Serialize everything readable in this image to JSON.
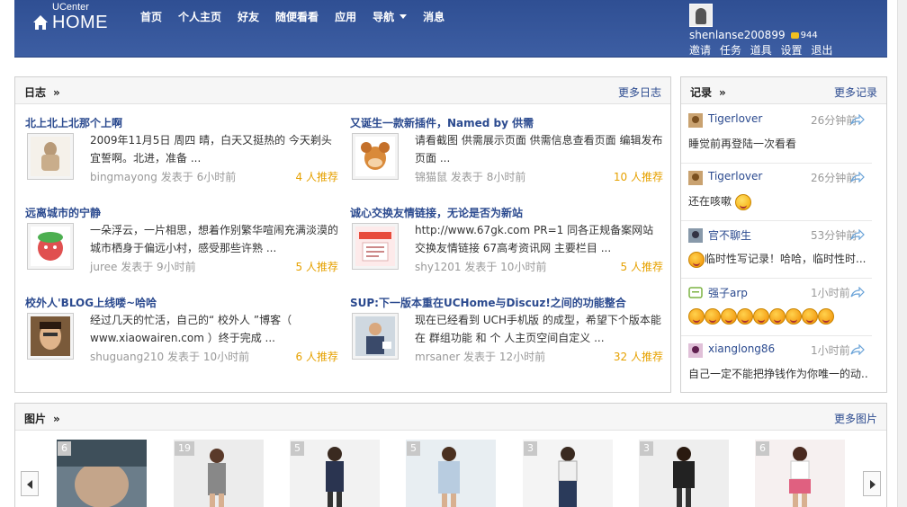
{
  "header": {
    "logo_small": "UCenter",
    "logo_big": "HOME",
    "nav": [
      "首页",
      "个人主页",
      "好友",
      "随便看看",
      "应用",
      "导航",
      "消息"
    ],
    "username": "shenlanse200899",
    "credit": "944",
    "user_links": [
      "邀请",
      "任务",
      "道具",
      "设置",
      "退出"
    ]
  },
  "blog": {
    "title": "日志",
    "arrow": "»",
    "more": "更多日志",
    "entries": [
      {
        "title": "北上北上北那个上啊",
        "text": "2009年11月5日 周四 晴，白天又挺热的  今天剃头宜誓啊。北进，准备 ...",
        "author": "bingmayong",
        "posted": "发表于",
        "time": "6小时前",
        "rec": "4 人推荐"
      },
      {
        "title": "又诞生一款新插件，Named by 供需",
        "text": "请看截图  供需展示页面 供需信息查看页面 编辑发布页面  ...",
        "author": "锦猫鼠",
        "posted": "发表于",
        "time": "8小时前",
        "rec": "10 人推荐"
      },
      {
        "title": "远离城市的宁静",
        "text": " 一朵浮云，一片相思，想着作别繁华喧闹充满淡漠的城市栖身于偏远小村，感受那些许熟  ...",
        "author": "juree",
        "posted": "发表于",
        "time": "9小时前",
        "rec": "5 人推荐"
      },
      {
        "title": "诚心交换友情链接，无论是否为新站",
        "text": "http://www.67gk.com PR=1 同各正规备案网站交换友情链接 67高考资讯网 主要栏目 ...",
        "author": "shy1201",
        "posted": "发表于",
        "time": "10小时前",
        "rec": "5 人推荐"
      },
      {
        "title": "校外人'BLOG上线喽~哈哈",
        "text": " 经过几天的忙活，自己的“ 校外人 ”博客（ www.xiaowairen.com ）终于完成  ...",
        "author": "shuguang210",
        "posted": "发表于",
        "time": "10小时前",
        "rec": "6 人推荐"
      },
      {
        "title": "SUP:下一版本重在UCHome与Discuz!之间的功能整合",
        "text": "现在已经看到 UCH手机版 的成型，希望下个版本能在 群组功能 和 个 人主页空间自定义  ...",
        "author": "mrsaner",
        "posted": "发表于",
        "time": "12小时前",
        "rec": "32 人推荐"
      }
    ]
  },
  "records": {
    "title": "记录",
    "arrow": "»",
    "more": "更多记录",
    "items": [
      {
        "name": "Tigerlover",
        "time": "26分钟前",
        "body": "睡觉前再登陆一次看看"
      },
      {
        "name": "Tigerlover",
        "time": "26分钟前",
        "body": "还在咳嗽"
      },
      {
        "name": "官不聊生",
        "time": "53分钟前",
        "body": "临时性写记录！哈哈，临时性时..."
      },
      {
        "name": "强子arp",
        "time": "1小时前",
        "body": ""
      },
      {
        "name": "xianglong86",
        "time": "1小时前",
        "body": "自己一定不能把挣钱作为你唯一的动..."
      }
    ]
  },
  "photos": {
    "title": "图片",
    "arrow": "»",
    "more": "更多图片",
    "counts": [
      "6",
      "19",
      "5",
      "5",
      "3",
      "3",
      "6"
    ]
  }
}
